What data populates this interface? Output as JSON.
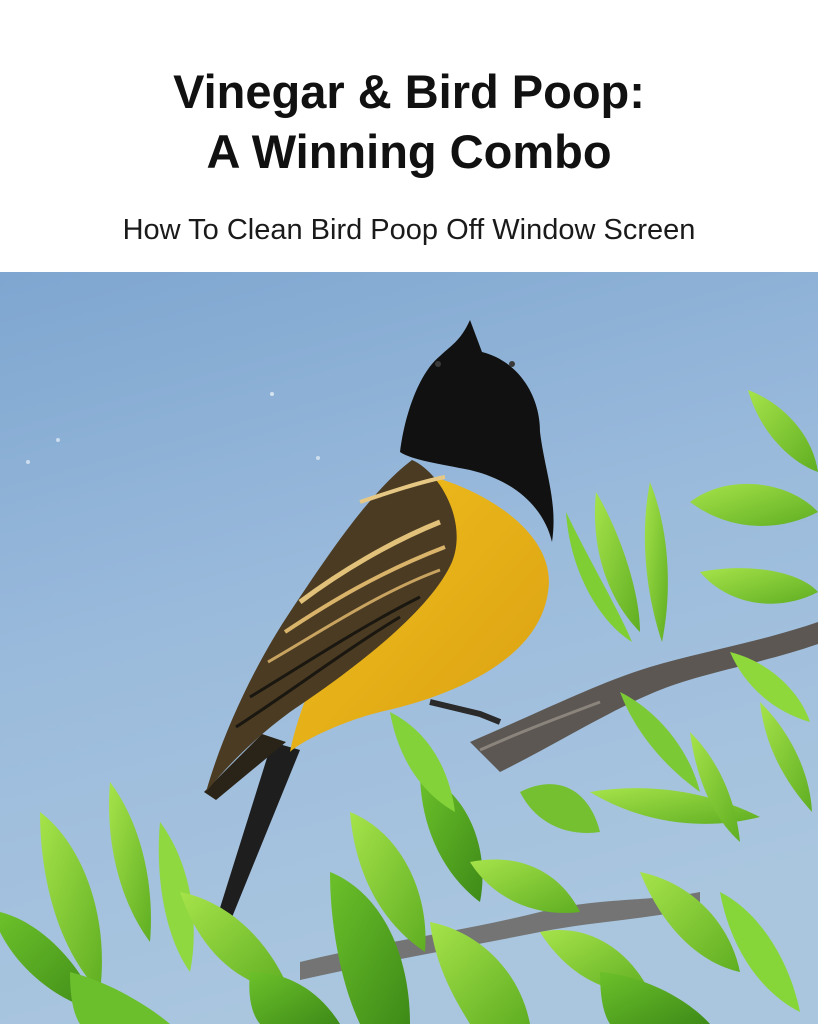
{
  "header": {
    "title_line1": "Vinegar & Bird Poop:",
    "title_line2": "A Winning Combo",
    "subtitle": "How To Clean Bird Poop Off Window Screen"
  },
  "photo": {
    "subject": "bird-on-branch",
    "colors": {
      "sky": "#8fb3d6",
      "bird_head": "#101010",
      "bird_belly": "#e8b21a",
      "wing": "#3a2e1c",
      "leaf": "#8fd63a",
      "branch": "#5a5550"
    }
  }
}
